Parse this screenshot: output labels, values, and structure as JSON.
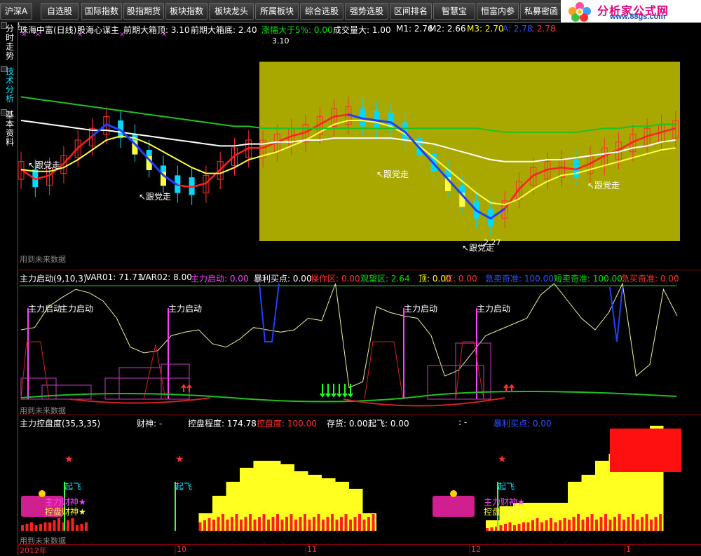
{
  "toolbar": {
    "buttons": [
      "沪深A股",
      "自选股",
      "国际指数",
      "股指期货",
      "板块指数",
      "板块龙头",
      "所属板块",
      "综合选股",
      "强势选股",
      "区间排名",
      "智慧宝",
      "恒富内参",
      "私募密函"
    ]
  },
  "logo": {
    "title": "分析家公式网",
    "url": "www.88gs.com"
  },
  "sidebar": {
    "tabs": [
      "分时走势",
      "技术分析",
      "基本资料"
    ]
  },
  "panel1": {
    "legend": [
      {
        "text": "珠海中富(日线)",
        "color": "#ffffff"
      },
      {
        "text": "股海心谋主",
        "color": "#ffffff"
      },
      {
        "text": "前期大箱顶: 3.10",
        "color": "#ffffff"
      },
      {
        "text": "前期大箱底: 2.40",
        "color": "#ffffff"
      },
      {
        "text": "涨幅大于5%: 0.00",
        "color": "#00e000"
      },
      {
        "text": "成交量大: 1.00",
        "color": "#ffffff"
      },
      {
        "text": "M1: 2.76",
        "color": "#ffffff"
      },
      {
        "text": "M2: 2.66",
        "color": "#ffffff"
      },
      {
        "text": "M3: 2.70",
        "color": "#ffff00"
      },
      {
        "text": "A: 2.78",
        "color": "#3050ff"
      },
      {
        "text": ": 2.78",
        "color": "#ff3030"
      }
    ],
    "peak_label": "3.10",
    "low_label": "2.27",
    "annotations": [
      "↖跟党走",
      "↖跟党走",
      "↖跟党走",
      "↖跟党走",
      "↖跟党走"
    ],
    "footer": "用到未来数据"
  },
  "panel2": {
    "legend": [
      {
        "text": "主力启动(9,10,3)",
        "color": "#ffffff"
      },
      {
        "text": "VAR01: 71.71",
        "color": "#ffffff"
      },
      {
        "text": "VAR02: 8.00",
        "color": "#ffffff"
      },
      {
        "text": "主力启动: 0.00",
        "color": "#ff40ff"
      },
      {
        "text": "暴利买点: 0.00",
        "color": "#ffffff"
      },
      {
        "text": "操作区: 0.00",
        "color": "#ff3030"
      },
      {
        "text": "观望区: 2.64",
        "color": "#00e000"
      },
      {
        "text": "顶: 0.00",
        "color": "#ffff00"
      },
      {
        "text": "底: 0.00",
        "color": "#ff3030"
      },
      {
        "text": "急卖奇准: 100.00",
        "color": "#3050ff"
      },
      {
        "text": "短卖奇准: 100.00",
        "color": "#00e000"
      },
      {
        "text": "急买奇准: 0.00",
        "color": "#ff3030"
      }
    ],
    "start_labels": [
      "主力启动",
      "主力启动",
      "主力启动",
      "主力启动",
      "主力启动"
    ],
    "footer": "用到未来数据"
  },
  "panel3": {
    "legend": [
      {
        "text": "主力控盘度(35,3,35)",
        "color": "#ffffff"
      },
      {
        "text": "财神: -",
        "color": "#ffffff"
      },
      {
        "text": "控盘程度: 174.78",
        "color": "#ffffff"
      },
      {
        "text": "控盘度: 100.00",
        "color": "#ff3030"
      },
      {
        "text": "存货: 0.00",
        "color": "#ffffff"
      },
      {
        "text": "起飞: 0.00",
        "color": "#ffffff"
      },
      {
        "text": ": -",
        "color": "#ffffff"
      },
      {
        "text": "暴利买点: 0.00",
        "color": "#3050ff"
      }
    ],
    "fly_labels": [
      "起飞",
      "起飞",
      "起飞"
    ],
    "badge_text": [
      "主力财神★",
      "控盘财神★"
    ],
    "footer": "用到未来数据"
  },
  "dates": [
    "2012年",
    "10",
    "11",
    "12",
    "1"
  ],
  "colors": {
    "up": "#ff3030",
    "down": "#00d8ff",
    "green": "#20c020",
    "yellow": "#ffff40",
    "box": "#a8a800"
  },
  "chart_data": [
    {
      "type": "candlestick",
      "title": "珠海中富(日线)",
      "ylim": [
        2.2,
        3.2
      ],
      "box_top": 3.1,
      "box_bottom": 2.4,
      "series": [
        {
          "name": "M1",
          "values": [
            2.55,
            2.5,
            2.52,
            2.58,
            2.66,
            2.72,
            2.78,
            2.75,
            2.68,
            2.6,
            2.52,
            2.47,
            2.46,
            2.48,
            2.55,
            2.62,
            2.66,
            2.66,
            2.69,
            2.72,
            2.74,
            2.78,
            2.82,
            2.83,
            2.81,
            2.8,
            2.79,
            2.74,
            2.66,
            2.58,
            2.5,
            2.42,
            2.34,
            2.3,
            2.35,
            2.45,
            2.52,
            2.55,
            2.56,
            2.55,
            2.58,
            2.62,
            2.65,
            2.69,
            2.72,
            2.74,
            2.76
          ]
        },
        {
          "name": "M2",
          "values": [
            2.55,
            2.54,
            2.54,
            2.56,
            2.6,
            2.65,
            2.7,
            2.72,
            2.71,
            2.68,
            2.64,
            2.6,
            2.56,
            2.53,
            2.53,
            2.56,
            2.6,
            2.62,
            2.64,
            2.67,
            2.7,
            2.74,
            2.78,
            2.8,
            2.8,
            2.79,
            2.77,
            2.73,
            2.67,
            2.61,
            2.55,
            2.49,
            2.43,
            2.38,
            2.37,
            2.4,
            2.45,
            2.49,
            2.52,
            2.53,
            2.55,
            2.57,
            2.59,
            2.61,
            2.63,
            2.65,
            2.66
          ]
        },
        {
          "name": "M3",
          "values": [
            2.8,
            2.79,
            2.78,
            2.77,
            2.76,
            2.75,
            2.75,
            2.74,
            2.73,
            2.72,
            2.71,
            2.7,
            2.69,
            2.68,
            2.67,
            2.67,
            2.68,
            2.68,
            2.69,
            2.69,
            2.7,
            2.7,
            2.71,
            2.71,
            2.71,
            2.71,
            2.71,
            2.7,
            2.69,
            2.68,
            2.66,
            2.64,
            2.62,
            2.6,
            2.59,
            2.59,
            2.59,
            2.6,
            2.6,
            2.61,
            2.62,
            2.63,
            2.64,
            2.66,
            2.67,
            2.69,
            2.7
          ]
        },
        {
          "name": "A",
          "values": [
            2.92,
            2.91,
            2.9,
            2.89,
            2.88,
            2.87,
            2.86,
            2.85,
            2.84,
            2.83,
            2.82,
            2.81,
            2.8,
            2.79,
            2.78,
            2.77,
            2.77,
            2.76,
            2.76,
            2.76,
            2.76,
            2.76,
            2.76,
            2.76,
            2.76,
            2.76,
            2.76,
            2.76,
            2.76,
            2.76,
            2.76,
            2.76,
            2.76,
            2.75,
            2.74,
            2.74,
            2.74,
            2.74,
            2.74,
            2.74,
            2.75,
            2.76,
            2.76,
            2.77,
            2.77,
            2.78,
            2.78
          ]
        }
      ]
    },
    {
      "type": "line",
      "title": "主力启动(9,10,3)",
      "series": [
        {
          "name": "VAR01",
          "values": [
            60,
            62,
            80,
            88,
            95,
            92,
            85,
            70,
            45,
            40,
            42,
            55,
            58,
            60,
            48,
            45,
            52,
            62,
            60,
            58,
            60,
            70,
            68,
            100,
            10,
            15,
            80,
            75,
            72,
            70,
            55,
            20,
            25,
            40,
            55,
            60,
            65,
            70,
            90,
            100,
            85,
            70,
            60,
            75,
            100,
            20,
            30,
            95,
            72
          ]
        }
      ]
    },
    {
      "type": "bar",
      "title": "主力控盘度(35,3,35)",
      "series": [
        {
          "name": "控盘程度",
          "values": [
            0,
            0,
            0,
            0,
            0,
            0,
            0,
            0,
            0,
            0,
            0,
            0,
            0,
            5,
            10,
            14,
            18,
            20,
            20,
            19,
            17,
            16,
            15,
            14,
            12,
            5,
            0,
            0,
            0,
            0,
            0,
            0,
            0,
            0,
            3,
            7,
            8,
            8,
            8,
            8,
            14,
            16,
            20,
            22,
            25,
            28,
            30
          ]
        },
        {
          "name": "控盘度",
          "values": [
            2,
            2,
            3,
            3,
            2,
            0,
            0,
            0,
            0,
            0,
            0,
            0,
            0,
            3,
            4,
            4,
            4,
            4,
            4,
            4,
            4,
            4,
            4,
            4,
            4,
            4,
            0,
            0,
            0,
            0,
            0,
            0,
            0,
            0,
            1,
            2,
            2,
            3,
            3,
            3,
            4,
            4,
            4,
            4,
            4,
            4,
            4
          ]
        }
      ]
    }
  ]
}
